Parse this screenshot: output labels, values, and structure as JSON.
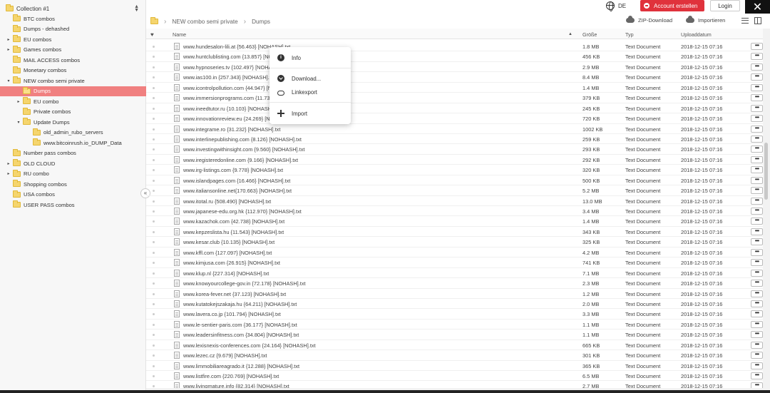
{
  "sidebar": {
    "collection": "Collection #1",
    "tree": [
      {
        "label": "BTC combos",
        "level": 1,
        "arrow": ""
      },
      {
        "label": "Dumps - dehashed",
        "level": 1,
        "arrow": ""
      },
      {
        "label": "EU combos",
        "level": 1,
        "arrow": "▸"
      },
      {
        "label": "Games combos",
        "level": 1,
        "arrow": "▸"
      },
      {
        "label": "MAIL ACCESS combos",
        "level": 1,
        "arrow": ""
      },
      {
        "label": "Monetary combos",
        "level": 1,
        "arrow": ""
      },
      {
        "label": "NEW combo semi private",
        "level": 1,
        "arrow": "▾"
      },
      {
        "label": "Dumps",
        "level": 2,
        "arrow": "",
        "selected": true
      },
      {
        "label": "EU combo",
        "level": 2,
        "arrow": "▸"
      },
      {
        "label": "Private combos",
        "level": 2,
        "arrow": ""
      },
      {
        "label": "Update Dumps",
        "level": 2,
        "arrow": "▾"
      },
      {
        "label": "old_admin_rubo_servers",
        "level": 3,
        "arrow": ""
      },
      {
        "label": "www.bitcoinrush.io_DUMP_Data",
        "level": 3,
        "arrow": ""
      },
      {
        "label": "Number pass combos",
        "level": 1,
        "arrow": ""
      },
      {
        "label": "OLD CLOUD",
        "level": 1,
        "arrow": "▸"
      },
      {
        "label": "RU combo",
        "level": 1,
        "arrow": "▸"
      },
      {
        "label": "Shopping combos",
        "level": 1,
        "arrow": ""
      },
      {
        "label": "USA combos",
        "level": 1,
        "arrow": ""
      },
      {
        "label": "USER PASS combos",
        "level": 1,
        "arrow": ""
      }
    ]
  },
  "header": {
    "lang": "DE",
    "create_account": "Account erstellen",
    "login": "Login",
    "close": "✕"
  },
  "breadcrumb": [
    "NEW combo semi private",
    "Dumps"
  ],
  "toolbar": {
    "zip": "ZIP-Download",
    "import": "Importieren"
  },
  "table": {
    "columns": {
      "name": "Name",
      "size": "Größe",
      "type": "Typ",
      "date": "Uploaddatum"
    },
    "rows": [
      {
        "name": "www.hundesalon-lili.at {56.463} [NOHASH].txt",
        "size": "1.8 MB",
        "type": "Text Document",
        "date": "2018-12-15 07:16"
      },
      {
        "name": "www.huntclublisting.com {13.857} [NOHASH].txt",
        "size": "456 KB",
        "type": "Text Document",
        "date": "2018-12-15 07:16"
      },
      {
        "name": "www.hypnoseries.tv {102.497} [NOHASH].txt",
        "size": "2.9 MB",
        "type": "Text Document",
        "date": "2018-12-15 07:16"
      },
      {
        "name": "www.ias100.in {257.343} [NOHASH].txt",
        "size": "8.4 MB",
        "type": "Text Document",
        "date": "2018-12-15 07:16"
      },
      {
        "name": "www.icontrolpollution.com {44.947} [NOHASH].txt",
        "size": "1.4 MB",
        "type": "Text Document",
        "date": "2018-12-15 07:16"
      },
      {
        "name": "www.immersionprograms.com {11.732} [NOHASH].txt",
        "size": "379 KB",
        "type": "Text Document",
        "date": "2018-12-15 07:16"
      },
      {
        "name": "www.ineedtutor.ru {10.103} [NOHASH].txt",
        "size": "245 KB",
        "type": "Text Document",
        "date": "2018-12-15 07:16"
      },
      {
        "name": "www.innovationreview.eu {24.269} [NOHASH].txt",
        "size": "720 KB",
        "type": "Text Document",
        "date": "2018-12-15 07:16"
      },
      {
        "name": "www.integrame.ro {31.232} [NOHASH].txt",
        "size": "1002 KB",
        "type": "Text Document",
        "date": "2018-12-15 07:16"
      },
      {
        "name": "www.interlinepublishing.com {8.126} [NOHASH].txt",
        "size": "259 KB",
        "type": "Text Document",
        "date": "2018-12-15 07:16"
      },
      {
        "name": "www.investingwithinsight.com {9.560} [NOHASH].txt",
        "size": "293 KB",
        "type": "Text Document",
        "date": "2018-12-15 07:16"
      },
      {
        "name": "www.iregisteredonline.com {9.166} [NOHASH].txt",
        "size": "292 KB",
        "type": "Text Document",
        "date": "2018-12-15 07:16"
      },
      {
        "name": "www.irg-listings.com {9.778} [NOHASH].txt",
        "size": "320 KB",
        "type": "Text Document",
        "date": "2018-12-15 07:16"
      },
      {
        "name": "www.islandpages.com {16.466} [NOHASH].txt",
        "size": "500 KB",
        "type": "Text Document",
        "date": "2018-12-15 07:16"
      },
      {
        "name": "www.italiansonline.net{170.663} [NOHASH].txt",
        "size": "5.2 MB",
        "type": "Text Document",
        "date": "2018-12-15 07:16"
      },
      {
        "name": "www.itotal.ru {508.490} [NOHASH].txt",
        "size": "13.0 MB",
        "type": "Text Document",
        "date": "2018-12-15 07:16"
      },
      {
        "name": "www.japanese-edu.org.hk {112.970} [NOHASH].txt",
        "size": "3.4 MB",
        "type": "Text Document",
        "date": "2018-12-15 07:16"
      },
      {
        "name": "www.kazachok.com {42.738} [NOHASH].txt",
        "size": "1.4 MB",
        "type": "Text Document",
        "date": "2018-12-15 07:16"
      },
      {
        "name": "www.kepzeslista.hu {11.543} [NOHASH].txt",
        "size": "343 KB",
        "type": "Text Document",
        "date": "2018-12-15 07:16"
      },
      {
        "name": "www.kesar.club {10.135} [NOHASH].txt",
        "size": "325 KB",
        "type": "Text Document",
        "date": "2018-12-15 07:16"
      },
      {
        "name": "www.kffl.com {127.097} [NOHASH].txt",
        "size": "4.2 MB",
        "type": "Text Document",
        "date": "2018-12-15 07:16"
      },
      {
        "name": "www.kimjusa.com {26.915} [NOHASH].txt",
        "size": "741 KB",
        "type": "Text Document",
        "date": "2018-12-15 07:16"
      },
      {
        "name": "www.klup.nl {227.314} [NOHASH].txt",
        "size": "7.1 MB",
        "type": "Text Document",
        "date": "2018-12-15 07:16"
      },
      {
        "name": "www.knowyourcollege-gov.in {72.178} [NOHASH].txt",
        "size": "2.3 MB",
        "type": "Text Document",
        "date": "2018-12-15 07:16"
      },
      {
        "name": "www.korea-fever.net {37.123} [NOHASH].txt",
        "size": "1.2 MB",
        "type": "Text Document",
        "date": "2018-12-15 07:16"
      },
      {
        "name": "www.kutatokejszakaja.hu {64.211} [NOHASH].txt",
        "size": "2.0 MB",
        "type": "Text Document",
        "date": "2018-12-15 07:16"
      },
      {
        "name": "www.lavera.co.jp {101.794} [NOHASH].txt",
        "size": "3.3 MB",
        "type": "Text Document",
        "date": "2018-12-15 07:16"
      },
      {
        "name": "www.le-sentier-paris.com {36.177} [NOHASH].txt",
        "size": "1.1 MB",
        "type": "Text Document",
        "date": "2018-12-15 07:16"
      },
      {
        "name": "www.leadersinfitness.com {34.804} [NOHASH].txt",
        "size": "1.1 MB",
        "type": "Text Document",
        "date": "2018-12-15 07:16"
      },
      {
        "name": "www.lexisnexis-conferences.com {24.164} [NOHASH].txt",
        "size": "665 KB",
        "type": "Text Document",
        "date": "2018-12-15 07:16"
      },
      {
        "name": "www.lezec.cz {9.679} [NOHASH].txt",
        "size": "301 KB",
        "type": "Text Document",
        "date": "2018-12-15 07:16"
      },
      {
        "name": "www.limmobiliareagrado.it {12.288} [NOHASH].txt",
        "size": "365 KB",
        "type": "Text Document",
        "date": "2018-12-15 07:16"
      },
      {
        "name": "www.listfire.com {220.769} [NOHASH].txt",
        "size": "6.5 MB",
        "type": "Text Document",
        "date": "2018-12-15 07:16"
      },
      {
        "name": "www.livingmature.info {82.314} [NOHASH].txt",
        "size": "2.7 MB",
        "type": "Text Document",
        "date": "2018-12-15 07:16"
      }
    ]
  },
  "context_menu": {
    "info": "Info",
    "download": "Download...",
    "linkexport": "Linkexport",
    "import": "Import"
  }
}
